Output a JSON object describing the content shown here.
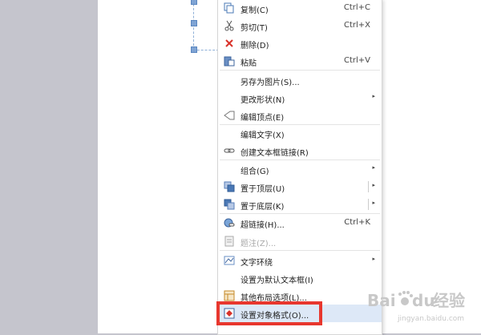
{
  "context_menu": {
    "items": [
      {
        "label": "复制(C)",
        "shortcut": "Ctrl+C",
        "icon": "copy-icon"
      },
      {
        "label": "剪切(T)",
        "shortcut": "Ctrl+X",
        "icon": "scissors-icon"
      },
      {
        "label": "删除(D)",
        "icon": "delete-x-icon"
      },
      {
        "label": "粘贴",
        "shortcut": "Ctrl+V",
        "icon": "paste-icon"
      },
      {
        "label": "另存为图片(S)..."
      },
      {
        "label": "更改形状(N)",
        "submenu": true
      },
      {
        "label": "编辑顶点(E)",
        "icon": "edit-points-icon"
      },
      {
        "label": "编辑文字(X)"
      },
      {
        "label": "创建文本框链接(R)",
        "icon": "link-chain-icon"
      },
      {
        "label": "组合(G)",
        "submenu": true
      },
      {
        "label": "置于顶层(U)",
        "submenu": true,
        "icon": "bring-to-front-icon"
      },
      {
        "label": "置于底层(K)",
        "submenu": true,
        "icon": "send-to-back-icon"
      },
      {
        "label": "超链接(H)...",
        "shortcut": "Ctrl+K",
        "icon": "hyperlink-globe-icon"
      },
      {
        "label": "题注(Z)...",
        "disabled": true,
        "icon": "caption-icon"
      },
      {
        "label": "文字环绕",
        "submenu": true,
        "icon": "text-wrap-icon"
      },
      {
        "label": "设置为默认文本框(I)"
      },
      {
        "label": "其他布局选项(L)...",
        "icon": "layout-options-icon"
      },
      {
        "label": "设置对象格式(O)...",
        "icon": "format-object-icon",
        "highlighted": true
      }
    ]
  },
  "watermark": {
    "brand": "Bai",
    "du": "du",
    "suffix": "经验",
    "url": "jingyan.baidu.com"
  },
  "colors": {
    "highlight": "#dde8f7",
    "annotation_red": "#e8372e",
    "canvas_bg": "#c5c5cd"
  }
}
